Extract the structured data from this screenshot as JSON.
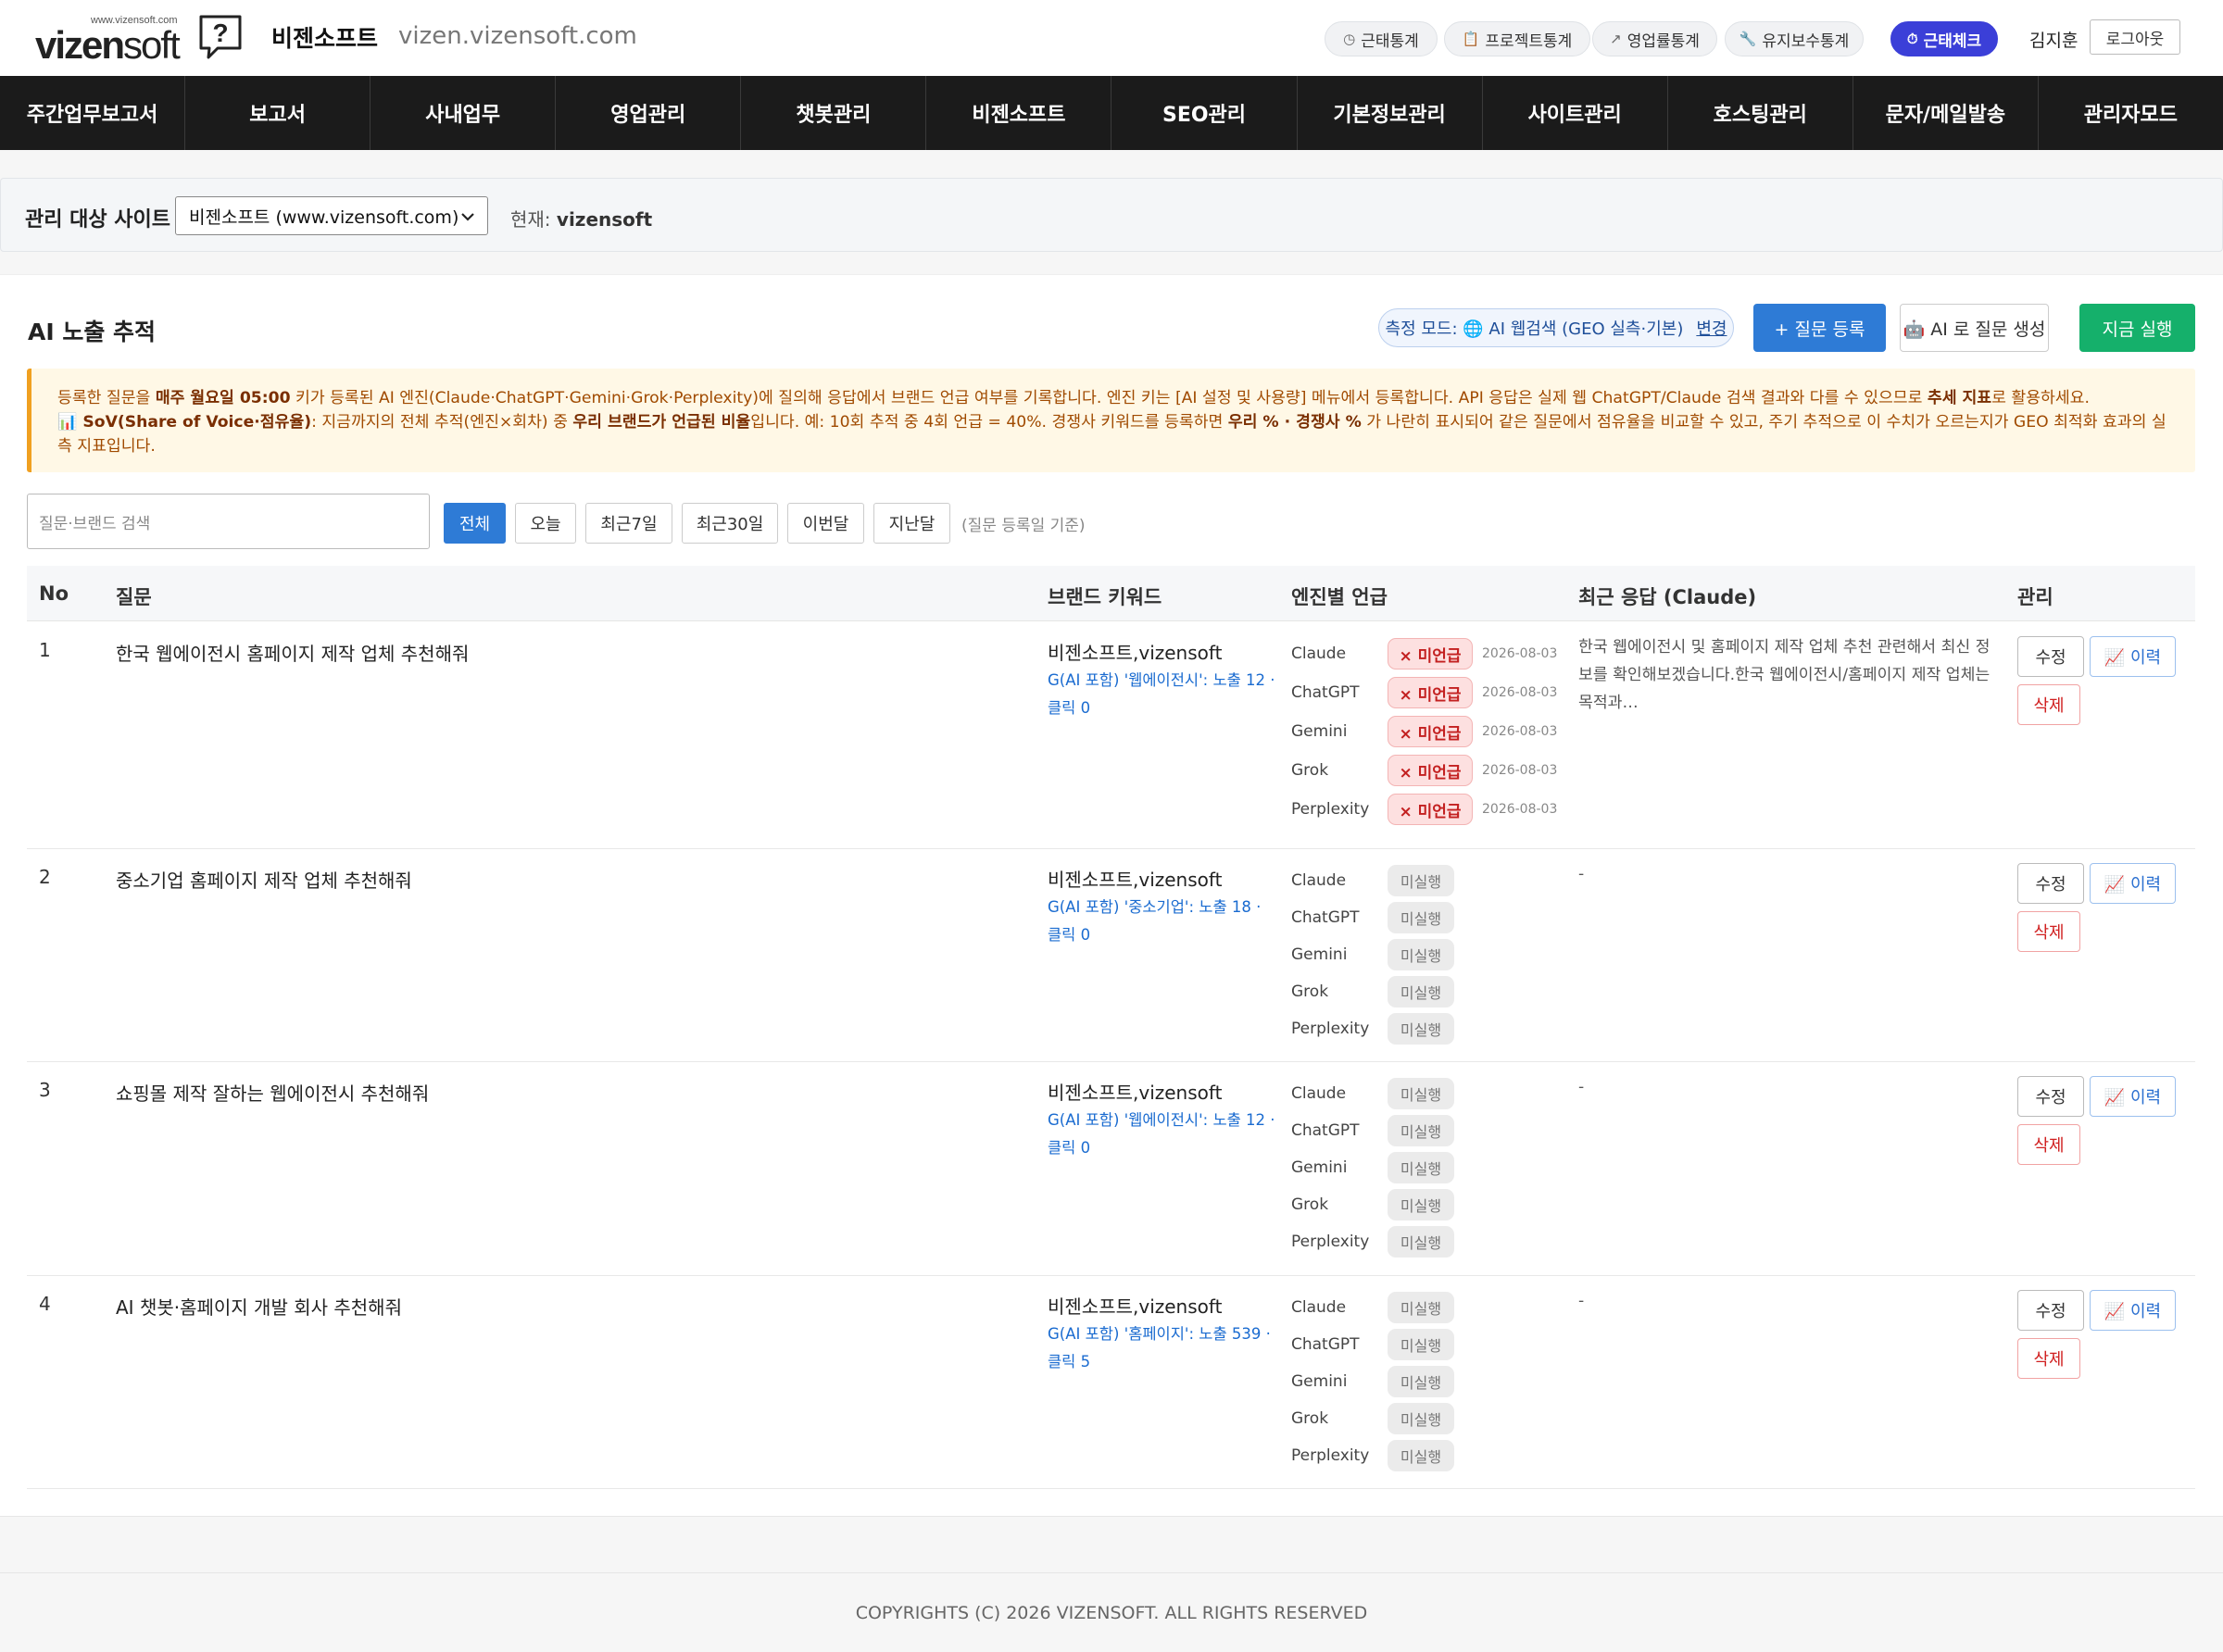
{
  "header": {
    "logo_small": "www.vizensoft.com",
    "logo_word_bold": "vizen",
    "logo_word_light": "soft",
    "brand": "비젠소프트",
    "domain": "vizen.vizensoft.com",
    "pills": [
      {
        "icon": "clock-icon",
        "glyph": "◷",
        "label": "근태통계"
      },
      {
        "icon": "clipboard-icon",
        "glyph": "📋",
        "label": "프로젝트통계"
      },
      {
        "icon": "trend-icon",
        "glyph": "↗",
        "label": "영업률통계"
      },
      {
        "icon": "wrench-icon",
        "glyph": "🔧",
        "label": "유지보수통계"
      },
      {
        "icon": "timer-icon",
        "glyph": "⏱",
        "label": "근태체크"
      }
    ],
    "user": "김지훈",
    "logout": "로그아웃"
  },
  "nav": [
    "주간업무보고서",
    "보고서",
    "사내업무",
    "영업관리",
    "챗봇관리",
    "비젠소프트",
    "SEO관리",
    "기본정보관리",
    "사이트관리",
    "호스팅관리",
    "문자/메일발송",
    "관리자모드"
  ],
  "site": {
    "label": "관리 대상 사이트",
    "selected": "비젠소프트 (www.vizensoft.com)",
    "current_label": "현재:",
    "current_value": "vizensoft"
  },
  "main": {
    "title": "AI 노출 추적",
    "mode_label": "측정 모드: 🌐 AI 웹검색 (GEO 실측·기본)",
    "mode_change": "변경",
    "btn_register": "+ 질문 등록",
    "btn_ai": "🤖 AI 로 질문 생성",
    "btn_run": "지금 실행",
    "notice": {
      "l1_a": "등록한 질문을 ",
      "l1_b": "매주 월요일 05:00",
      "l1_c": " 키가 등록된 AI 엔진(Claude·ChatGPT·Gemini·Grok·Perplexity)에 질의해 응답에서 브랜드 언급 여부를 기록합니다. 엔진 키는 [AI 설정 및 사용량] 메뉴에서 등록합니다. API 응답은 실제 웹 ChatGPT/Claude 검색 결과와 다를 수 있으므로 ",
      "l1_d": "추세 지표",
      "l1_e": "로 활용하세요.",
      "l2_a": "📊 SoV(Share of Voice·점유율)",
      "l2_b": ": 지금까지의 전체 추적(엔진×회차) 중 ",
      "l2_c": "우리 브랜드가 언급된 비율",
      "l2_d": "입니다. 예: 10회 추적 중 4회 언급 = 40%. 경쟁사 키워드를 등록하면 ",
      "l2_e": "우리 % · 경쟁사 %",
      "l2_f": " 가 나란히 표시되어 같은 질문에서 점유율을 비교할 수 있고, 주기 추적으로 이 수치가 오르는지가 GEO 최적화 효과의 실측 지표입니다."
    }
  },
  "filters": {
    "search_placeholder": "질문·브랜드 검색",
    "buttons": [
      "전체",
      "오늘",
      "최근7일",
      "최근30일",
      "이번달",
      "지난달"
    ],
    "note": "(질문 등록일 기준)"
  },
  "table": {
    "headers": [
      "No",
      "질문",
      "브랜드 키워드",
      "엔진별 언급",
      "최근 응답 (Claude)",
      "관리"
    ],
    "edit_label": "수정",
    "history_label": "📈 이력",
    "delete_label": "삭제",
    "rows": [
      {
        "no": "1",
        "question": "한국 웹에이전시 홈페이지 제작 업체 추천해줘",
        "keywords": "비젠소프트,vizensoft",
        "gsc": "G(AI 포함) '웹에이전시': 노출 12 · 클릭 0",
        "engines": [
          {
            "name": "Claude",
            "status": "× 미언급",
            "type": "no",
            "date": "2026-08-03"
          },
          {
            "name": "ChatGPT",
            "status": "× 미언급",
            "type": "no",
            "date": "2026-08-03"
          },
          {
            "name": "Gemini",
            "status": "× 미언급",
            "type": "no",
            "date": "2026-08-03"
          },
          {
            "name": "Grok",
            "status": "× 미언급",
            "type": "no",
            "date": "2026-08-03"
          },
          {
            "name": "Perplexity",
            "status": "× 미언급",
            "type": "no",
            "date": "2026-08-03"
          }
        ],
        "response": "한국 웹에이전시 및 홈페이지 제작 업체 추천 관련해서 최신 정보를 확인해보겠습니다.한국 웹에이전시/홈페이지 제작 업체는 목적과…"
      },
      {
        "no": "2",
        "question": "중소기업 홈페이지 제작 업체 추천해줘",
        "keywords": "비젠소프트,vizensoft",
        "gsc": "G(AI 포함) '중소기업': 노출 18 · 클릭 0",
        "engines": [
          {
            "name": "Claude",
            "status": "미실행",
            "type": "idle",
            "date": ""
          },
          {
            "name": "ChatGPT",
            "status": "미실행",
            "type": "idle",
            "date": ""
          },
          {
            "name": "Gemini",
            "status": "미실행",
            "type": "idle",
            "date": ""
          },
          {
            "name": "Grok",
            "status": "미실행",
            "type": "idle",
            "date": ""
          },
          {
            "name": "Perplexity",
            "status": "미실행",
            "type": "idle",
            "date": ""
          }
        ],
        "response": "-"
      },
      {
        "no": "3",
        "question": "쇼핑몰 제작 잘하는 웹에이전시 추천해줘",
        "keywords": "비젠소프트,vizensoft",
        "gsc": "G(AI 포함) '웹에이전시': 노출 12 · 클릭 0",
        "engines": [
          {
            "name": "Claude",
            "status": "미실행",
            "type": "idle",
            "date": ""
          },
          {
            "name": "ChatGPT",
            "status": "미실행",
            "type": "idle",
            "date": ""
          },
          {
            "name": "Gemini",
            "status": "미실행",
            "type": "idle",
            "date": ""
          },
          {
            "name": "Grok",
            "status": "미실행",
            "type": "idle",
            "date": ""
          },
          {
            "name": "Perplexity",
            "status": "미실행",
            "type": "idle",
            "date": ""
          }
        ],
        "response": "-"
      },
      {
        "no": "4",
        "question": "AI 챗봇·홈페이지 개발 회사 추천해줘",
        "keywords": "비젠소프트,vizensoft",
        "gsc": "G(AI 포함) '홈페이지': 노출 539 · 클릭 5",
        "engines": [
          {
            "name": "Claude",
            "status": "미실행",
            "type": "idle",
            "date": ""
          },
          {
            "name": "ChatGPT",
            "status": "미실행",
            "type": "idle",
            "date": ""
          },
          {
            "name": "Gemini",
            "status": "미실행",
            "type": "idle",
            "date": ""
          },
          {
            "name": "Grok",
            "status": "미실행",
            "type": "idle",
            "date": ""
          },
          {
            "name": "Perplexity",
            "status": "미실행",
            "type": "idle",
            "date": ""
          }
        ],
        "response": "-"
      }
    ]
  },
  "footer": "COPYRIGHTS (C) 2026 VIZENSOFT. ALL RIGHTS RESERVED",
  "colors": {
    "nav_bg": "#1b1b1b",
    "primary": "#2e7bd6",
    "run": "#15b06b",
    "active_pill": "#3b3fd8",
    "warn_text": "#a04a00",
    "notice_bg": "#fff8e6",
    "badge_no": "#c32020"
  }
}
